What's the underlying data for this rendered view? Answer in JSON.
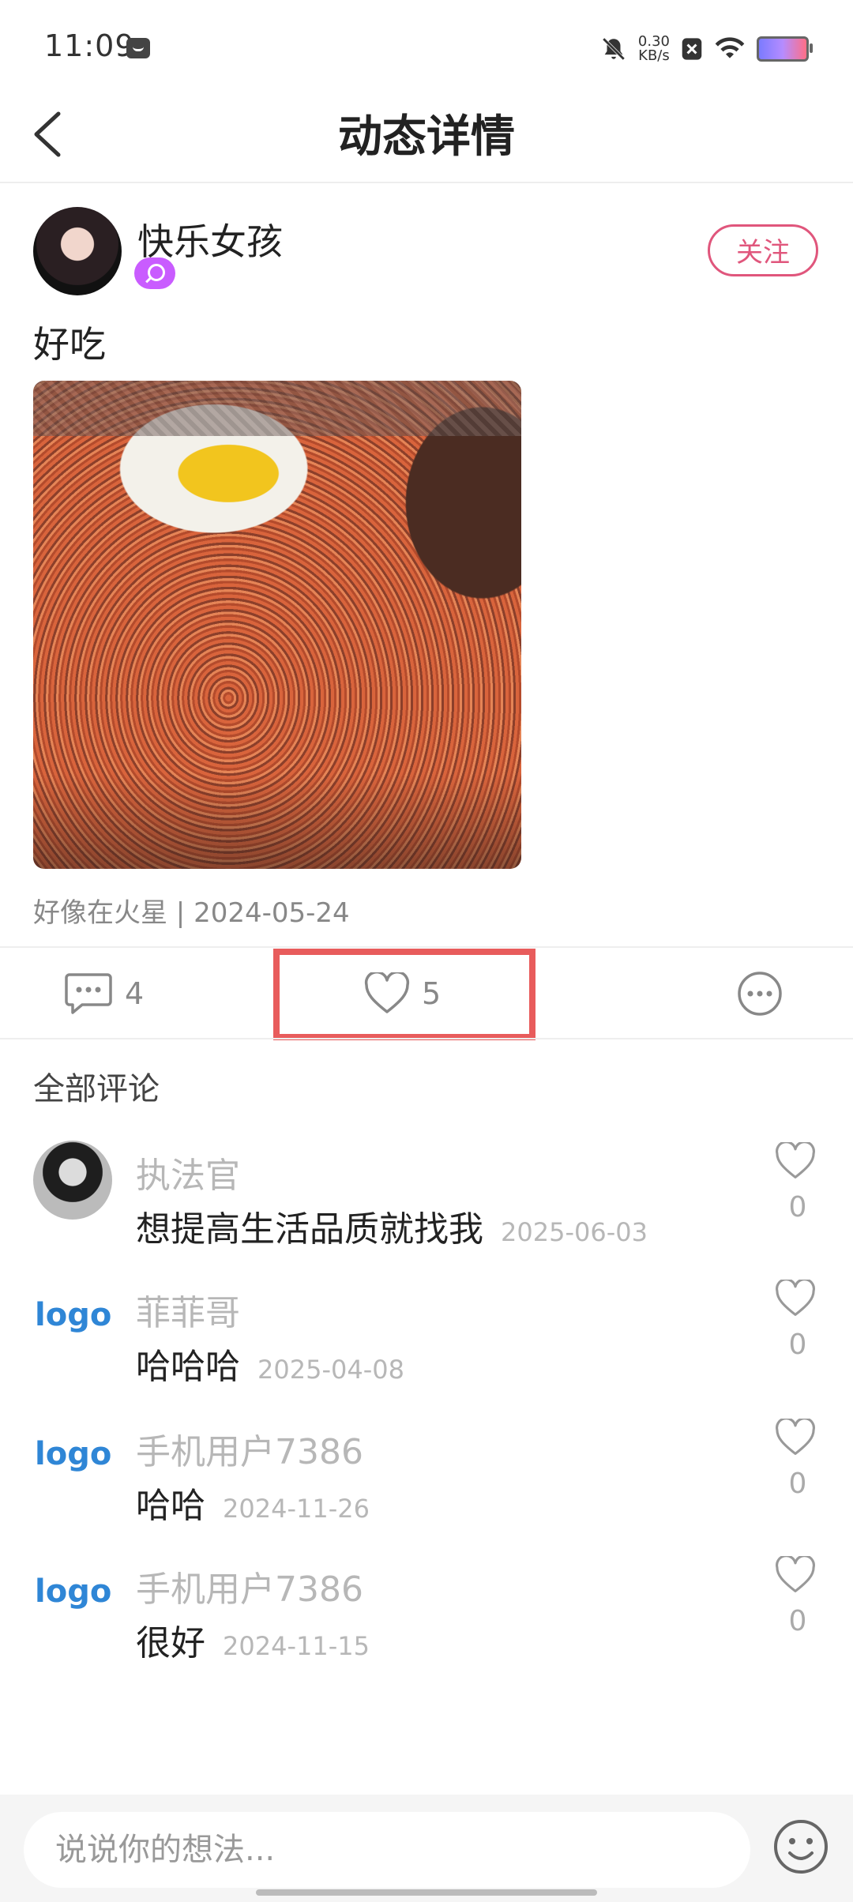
{
  "status_bar": {
    "time": "11:09",
    "speed_value": "0.30",
    "speed_unit": "KB/s"
  },
  "header": {
    "title": "动态详情"
  },
  "post": {
    "author": {
      "name": "快乐女孩",
      "follow_label": "关注"
    },
    "text": "好吃",
    "meta": "好像在火星 | 2024-05-24",
    "comment_count": "4",
    "like_count": "5"
  },
  "comments_section": {
    "title": "全部评论",
    "items": [
      {
        "avatar_type": "photo",
        "avatar_label": "",
        "name": "执法官",
        "text": "想提高生活品质就找我",
        "date": "2025-06-03",
        "likes": "0"
      },
      {
        "avatar_type": "logo",
        "avatar_label": "logo",
        "name": "菲菲哥",
        "text": "哈哈哈",
        "date": "2025-04-08",
        "likes": "0"
      },
      {
        "avatar_type": "logo",
        "avatar_label": "logo",
        "name": "手机用户7386",
        "text": "哈哈",
        "date": "2024-11-26",
        "likes": "0"
      },
      {
        "avatar_type": "logo",
        "avatar_label": "logo",
        "name": "手机用户7386",
        "text": "很好",
        "date": "2024-11-15",
        "likes": "0"
      }
    ]
  },
  "input": {
    "placeholder": "说说你的想法..."
  },
  "colors": {
    "accent_pink": "#e0567c",
    "logo_blue": "#2f86d6",
    "highlight_red": "#e85c5c"
  },
  "icons": [
    "back-icon",
    "comment-icon",
    "heart-icon",
    "more-icon",
    "emoji-icon",
    "wifi-icon",
    "mute-icon",
    "battery-icon"
  ]
}
